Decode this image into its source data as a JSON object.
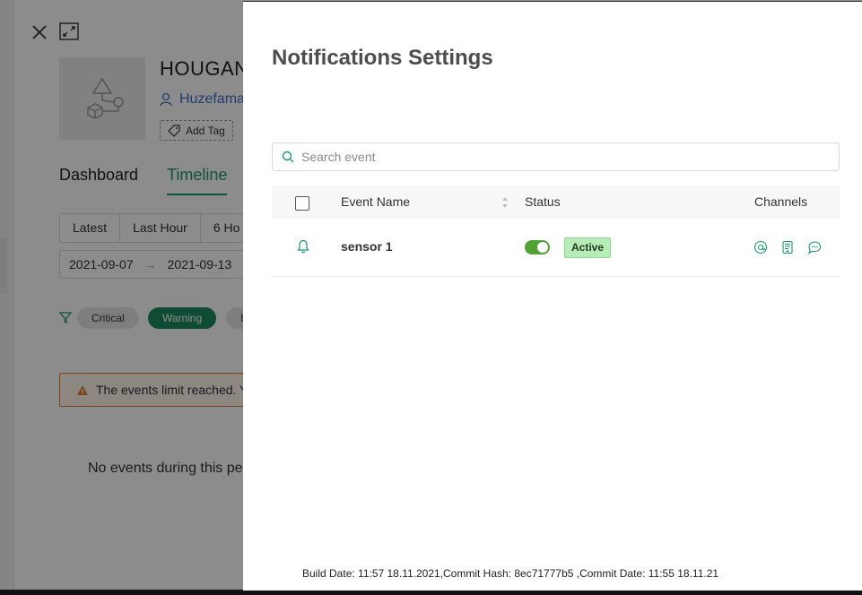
{
  "background": {
    "asset_title": "HOUGAN",
    "owner": "Huzefama",
    "add_tag_label": "Add Tag",
    "tabs": [
      {
        "label": "Dashboard",
        "active": false
      },
      {
        "label": "Timeline",
        "active": true
      }
    ],
    "time_ranges": [
      "Latest",
      "Last Hour",
      "6 Ho"
    ],
    "date_from": "2021-09-07",
    "date_to": "2021-09-13",
    "severity_filters": [
      {
        "label": "Critical",
        "selected": false
      },
      {
        "label": "Warning",
        "selected": true
      },
      {
        "label": "I",
        "selected": false
      }
    ],
    "alert_text": "The events limit reached. Y",
    "empty_text": "No events during this pe"
  },
  "drawer": {
    "title": "Notifications Settings",
    "search": {
      "placeholder": "Search event",
      "value": ""
    },
    "table": {
      "columns": [
        "Event Name",
        "Status",
        "Channels"
      ],
      "rows": [
        {
          "icon": "bell-icon",
          "event_name": "sensor 1",
          "enabled": true,
          "status": "Active",
          "channels": [
            "email-icon",
            "sms-icon",
            "chat-icon"
          ]
        }
      ]
    },
    "colors": {
      "accent": "#52a135",
      "badge_bg": "#b7ebb7"
    }
  },
  "footer": {
    "build_info": "Build Date: 11:57 18.11.2021,Commit Hash: 8ec71777b5 ,Commit Date: 11:55 18.11.21"
  }
}
